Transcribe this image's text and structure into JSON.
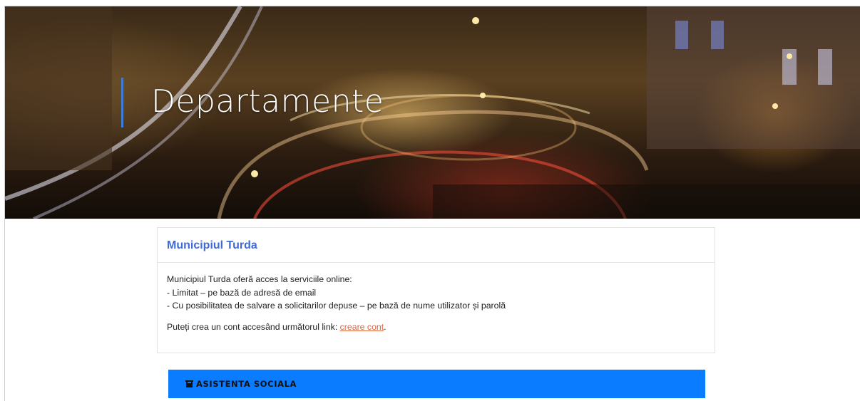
{
  "hero": {
    "title": "Departamente"
  },
  "card": {
    "title": "Municipiul Turda",
    "intro": "Municipiul Turda oferă acces la serviciile online:",
    "option_1": "- Limitat – pe bază de adresă de email",
    "option_2": "- Cu posibilitatea de salvare a solicitarilor depuse – pe bază de nume utilizator și parolă",
    "account_text": "Puteți crea un cont accesând următorul link: ",
    "account_link": "creare cont",
    "account_suffix": "."
  },
  "department_bar": {
    "icon": "building-icon",
    "label": "ASISTENTA SOCIALA",
    "color": "#0a7cff"
  },
  "colors": {
    "title_blue": "#3f6ad8",
    "link_orange": "#e0663c",
    "hero_accent": "#3b7dd8"
  }
}
